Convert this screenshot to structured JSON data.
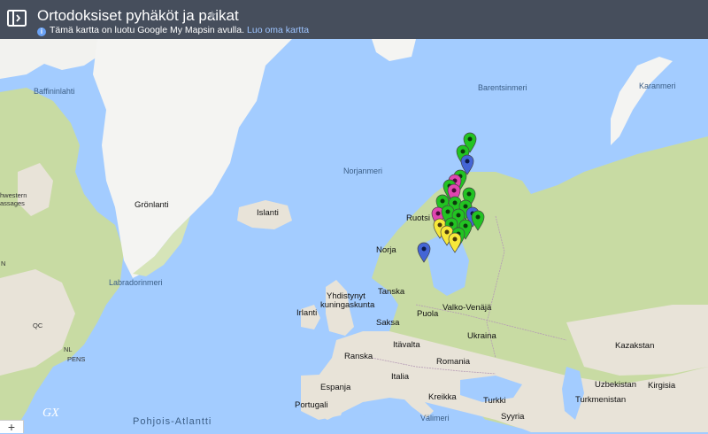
{
  "header": {
    "title": "Ortodoksiset pyhäköt ja paikat",
    "subtitle_text": "Tämä kartta on luotu Google My Mapsin avulla.",
    "subtitle_link": "Luo oma kartta",
    "info_icon_glyph": "i",
    "star_glyph": "★"
  },
  "map": {
    "zoom_in_glyph": "+",
    "signature": "GX",
    "colors": {
      "water": "#a3ccff",
      "land": "#e8e3d8",
      "ice": "#f4f4f2",
      "forest": "#c8dba3",
      "green_pin": "#22c322",
      "blue_pin": "#4465d6",
      "yellow_pin": "#f7e83a",
      "pink_pin": "#e045b0"
    },
    "labels": {
      "baffininlahti": "Baffininlahti",
      "gronlanti": "Grönlanti",
      "norjanmeri": "Norjanmeri",
      "barentsinmeri": "Barentsinmeri",
      "karanmeri": "Karanmeri",
      "islanti": "Islanti",
      "ruotsi": "Ruotsi",
      "norja": "Norja",
      "labradorinmeri": "Labradorinmeri",
      "tanska": "Tanska",
      "yhdistynyt_1": "Yhdistynyt",
      "yhdistynyt_2": "kuningaskunta",
      "irlanti": "Irlanti",
      "puola": "Puola",
      "valko_venaja": "Valko-Venäjä",
      "saksa": "Saksa",
      "ukraina": "Ukraina",
      "kazakstan": "Kazakstan",
      "itavalta": "Itävalta",
      "ranska": "Ranska",
      "romania": "Romania",
      "italia": "Italia",
      "espanja": "Espanja",
      "kreikka": "Kreikka",
      "turkki": "Turkki",
      "uzbekistan": "Uzbekistan",
      "kirgisia": "Kirgisia",
      "turkmenistan": "Turkmenistan",
      "portugali": "Portugali",
      "syyria": "Syyria",
      "valimeri": "Välimeri",
      "pohjois_atlantti": "Pohjois-Atlantti",
      "hwestern_1": "hwestern",
      "hwestern_2": "assages",
      "qc": "QC",
      "nl": "NL",
      "pe": "PE",
      "ns": "NS",
      "n_left": "N"
    }
  }
}
